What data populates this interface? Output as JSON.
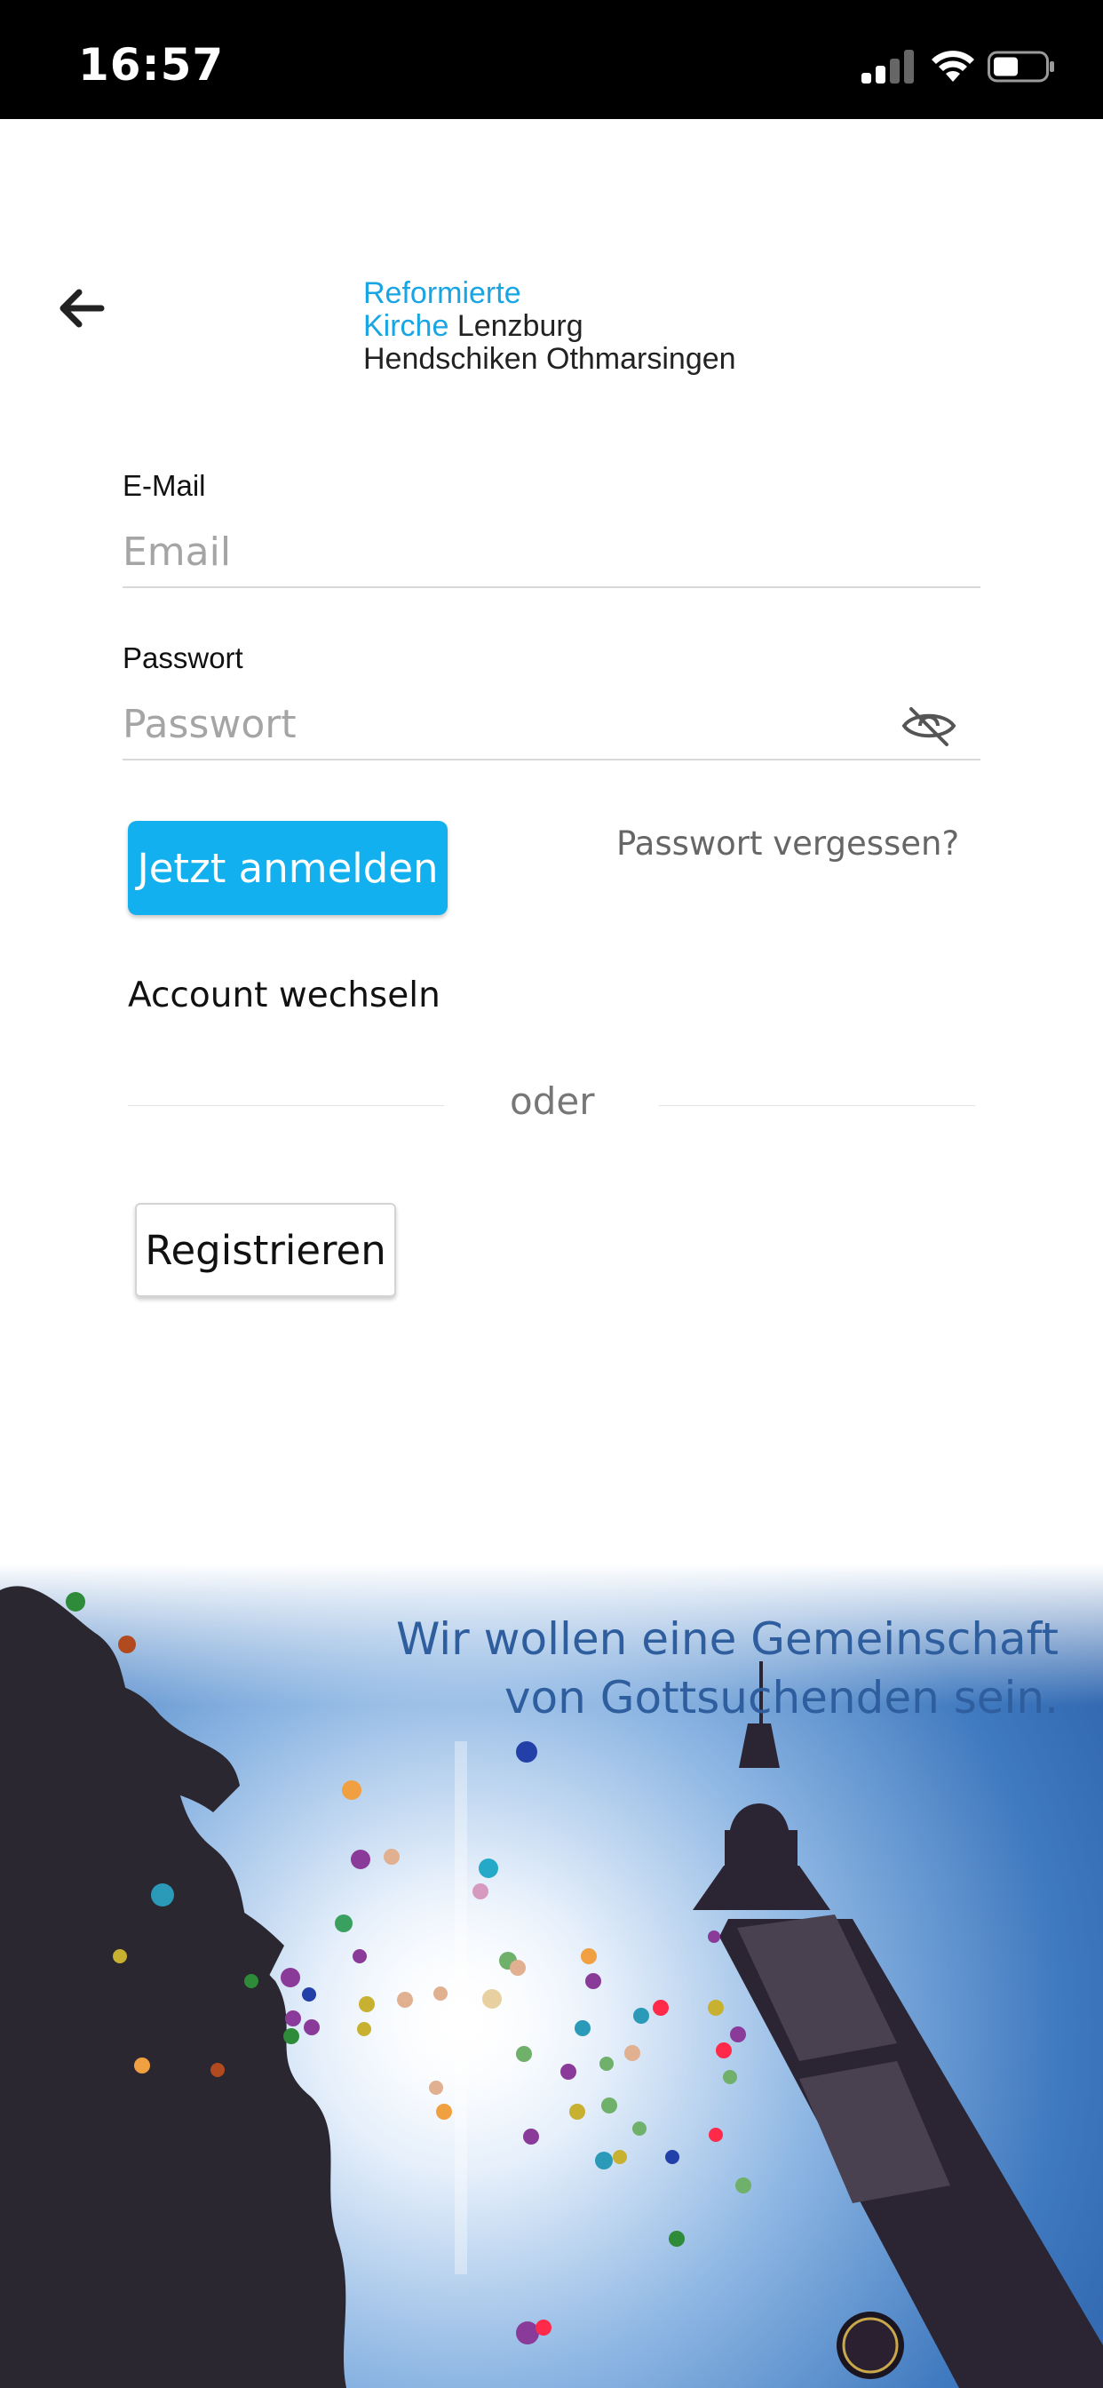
{
  "status_bar": {
    "time": "16:57",
    "icons": [
      "cellular-signal-icon",
      "wifi-icon",
      "battery-icon"
    ]
  },
  "header": {
    "back_icon": "arrow-left-icon",
    "logo": {
      "line1_blue": "Reformierte",
      "line2_blue": "Kirche",
      "line2_dark": " Lenzburg",
      "line3": "Hendschiken Othmarsingen"
    }
  },
  "form": {
    "email_label": "E-Mail",
    "email_placeholder": "Email",
    "email_value": "",
    "password_label": "Passwort",
    "password_placeholder": "Passwort",
    "password_value": "",
    "password_toggle_icon": "eye-slash-icon",
    "login_button": "Jetzt anmelden",
    "forgot_link": "Passwort vergessen?",
    "switch_account": "Account wechseln",
    "divider_text": "oder",
    "register_button": "Registrieren"
  },
  "hero": {
    "slogan_line1": "Wir wollen eine Gemeinschaft",
    "slogan_line2": "von Gottsuchenden sein."
  },
  "colors": {
    "accent": "#13b0ef",
    "logo_blue": "#17a5e3",
    "slogan_blue": "#2f5e9e",
    "sky": "#4d86c6"
  }
}
